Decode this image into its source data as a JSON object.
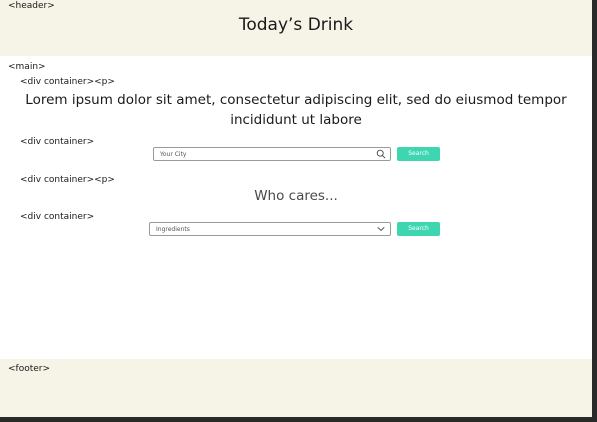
{
  "header": {
    "tag": "<header>",
    "title": "Today’s Drink"
  },
  "main": {
    "tag": "<main>",
    "intro_tag": "<div container><p>",
    "intro_text": "Lorem ipsum dolor sit amet, consectetur adipiscing elit, sed do eiusmod tempor incididunt ut labore",
    "city_container_tag": "<div container>",
    "city_search": {
      "placeholder": "Your City",
      "icon": "search-icon",
      "button_label": "Search"
    },
    "who_tag": "<div container><p>",
    "who_text": "Who cares...",
    "ingredients_container_tag": "<div container>",
    "ingredients_select": {
      "placeholder": "Ingredients",
      "icon": "chevron-down-icon",
      "button_label": "Search"
    }
  },
  "footer": {
    "tag": "<footer>"
  },
  "colors": {
    "header_footer_bg": "#f6f3e7",
    "accent_button": "#3dd6b0",
    "frame": "#2a2a2a"
  }
}
